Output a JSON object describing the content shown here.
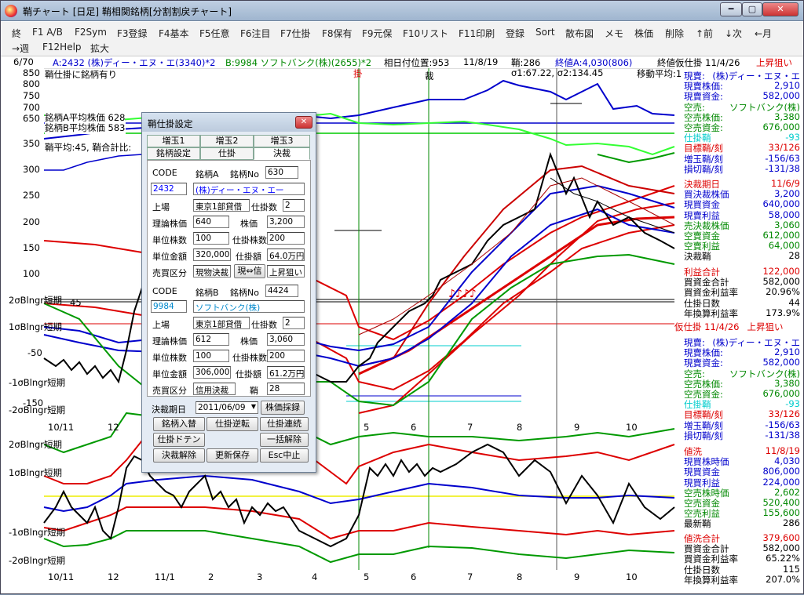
{
  "window": {
    "title": "鞘チャート [日足] 鞘相関銘柄[分割割戻チャート]"
  },
  "menu": {
    "row1": [
      "終",
      "F1 A/B",
      "F2Sym",
      "F3登録",
      "F4基本",
      "F5任意",
      "F6注目",
      "F7仕掛",
      "F8保有",
      "F9元保",
      "F10リスト",
      "F11印刷",
      "登録",
      "Sort",
      "散布図",
      "メモ",
      "株価",
      "削除",
      "↑前",
      "↓次",
      "←月"
    ],
    "row2": [
      "→週",
      "F12Help",
      "拡大"
    ]
  },
  "info": {
    "count": "6/70",
    "a": "A:2432 (株)ディー・エヌ・エ(3340)*2",
    "b": "B:9984 ソフトバンク(株)(2655)*2",
    "pos": "相日付位置:953",
    "date": "11/8/19",
    "saya": "鞘:286",
    "endval": "終値A:4,030(806)",
    "entry": "終値仮仕掛 11/4/26",
    "trend": "上昇狙い"
  },
  "chart": {
    "labels": {
      "top_left": "鞘仕掛に銘柄有り",
      "avgA": "銘柄A平均株価 628",
      "avgB": "銘柄B平均株価 583",
      "meanratio": "鞘平均:45, 鞘合計比:",
      "sigma": "σ1:67.22, σ2:134.45",
      "ma": "移動平均:1",
      "kake": "掛",
      "sai": "裁",
      "notes": "♪♪♪♪"
    },
    "yticks_top": [
      "850",
      "800",
      "750",
      "700",
      "650",
      "400",
      "350",
      "300",
      "250",
      "200",
      "150",
      "100"
    ],
    "yticks_mid": [
      "2σBlngr短期",
      "1σBlngr短期",
      "-50",
      "-1σBlngr短期",
      "-2σBlngr短期",
      "-150"
    ],
    "yticks_low": [
      "2σBlngr短期",
      "1σBlngr短期",
      "-1σBlngr短期",
      "-2σBlngr短期"
    ],
    "xticks_mid": [
      "10/11",
      "12",
      "5",
      "6",
      "7",
      "8",
      "9",
      "10"
    ],
    "xticks_low": [
      "10/11",
      "12",
      "11/1",
      "2",
      "3",
      "4",
      "5",
      "6",
      "7",
      "8",
      "9",
      "10"
    ],
    "extra": {
      "y45": "45",
      "neg100": "-100",
      "neg150": "-150"
    }
  },
  "right_panel": {
    "section1": [
      {
        "label": "現賣:",
        "value": "(株)ディー・エヌ・エ",
        "color": "#00c"
      },
      {
        "label": "現賣株価:",
        "value": "2,910",
        "color": "#00c"
      },
      {
        "label": "現賣資金:",
        "value": "582,000",
        "color": "#00c"
      },
      {
        "label": "空売:",
        "value": "ソフトバンク(株)",
        "color": "#080"
      },
      {
        "label": "空売株価:",
        "value": "3,380",
        "color": "#080"
      },
      {
        "label": "空売資金:",
        "value": "676,000",
        "color": "#080"
      },
      {
        "label": "仕掛鞘",
        "value": "-93",
        "color": "#0cc"
      },
      {
        "label": "目標鞘/刻",
        "value": "33/126",
        "color": "#d00"
      },
      {
        "label": "増玉鞘/刻",
        "value": "-156/63",
        "color": "#00c"
      },
      {
        "label": "損切鞘/刻",
        "value": "-131/38",
        "color": "#00c"
      }
    ],
    "section2": [
      {
        "label": "決裁期日",
        "value": "11/6/9",
        "color": "#d00"
      },
      {
        "label": "買決裁株価",
        "value": "3,200",
        "color": "#00c"
      },
      {
        "label": "現買資金",
        "value": "640,000",
        "color": "#00c"
      },
      {
        "label": "現賣利益",
        "value": "58,000",
        "color": "#00c"
      },
      {
        "label": "売決裁株価",
        "value": "3,060",
        "color": "#080"
      },
      {
        "label": "空賣資金",
        "value": "612,000",
        "color": "#080"
      },
      {
        "label": "空賣利益",
        "value": "64,000",
        "color": "#080"
      },
      {
        "label": "決裁鞘",
        "value": "28",
        "color": "#000"
      }
    ],
    "section3": [
      {
        "label": "利益合計",
        "value": "122,000",
        "color": "#d00"
      },
      {
        "label": "買資金合計",
        "value": "582,000",
        "color": "#000"
      },
      {
        "label": "買資金利益率",
        "value": "20.96%",
        "color": "#000"
      },
      {
        "label": "仕掛日数",
        "value": "44",
        "color": "#000"
      },
      {
        "label": "年換算利益率",
        "value": "173.9%",
        "color": "#000"
      }
    ],
    "entry2": {
      "text": "仮仕掛 11/4/26",
      "trend": "上昇狙い"
    },
    "section4": [
      {
        "label": "現賣:",
        "value": "(株)ディー・エヌ・エ",
        "color": "#00c"
      },
      {
        "label": "現賣株価:",
        "value": "2,910",
        "color": "#00c"
      },
      {
        "label": "現賣資金:",
        "value": "582,000",
        "color": "#00c"
      },
      {
        "label": "空売:",
        "value": "ソフトバンク(株)",
        "color": "#080"
      },
      {
        "label": "空売株価:",
        "value": "3,380",
        "color": "#080"
      },
      {
        "label": "空売資金:",
        "value": "676,000",
        "color": "#080"
      },
      {
        "label": "仕掛鞘",
        "value": "-93",
        "color": "#0cc"
      },
      {
        "label": "目標鞘/刻",
        "value": "33/126",
        "color": "#d00"
      },
      {
        "label": "増玉鞘/刻",
        "value": "-156/63",
        "color": "#00c"
      },
      {
        "label": "損切鞘/刻",
        "value": "-131/38",
        "color": "#00c"
      }
    ],
    "section5": [
      {
        "label": "値洗",
        "value": "11/8/19",
        "color": "#d00"
      },
      {
        "label": "現買株時価",
        "value": "4,030",
        "color": "#00c"
      },
      {
        "label": "現買資金",
        "value": "806,000",
        "color": "#00c"
      },
      {
        "label": "現買利益",
        "value": "224,000",
        "color": "#00c"
      },
      {
        "label": "空売株時価",
        "value": "2,602",
        "color": "#080"
      },
      {
        "label": "空売資金",
        "value": "520,400",
        "color": "#080"
      },
      {
        "label": "空売利益",
        "value": "155,600",
        "color": "#080"
      },
      {
        "label": "最新鞘",
        "value": "286",
        "color": "#000"
      }
    ],
    "section6": [
      {
        "label": "値洗合計",
        "value": "379,600",
        "color": "#d00"
      },
      {
        "label": "買資金合計",
        "value": "582,000",
        "color": "#000"
      },
      {
        "label": "買資金利益率",
        "value": "65.22%",
        "color": "#000"
      },
      {
        "label": "仕掛日数",
        "value": "115",
        "color": "#000"
      },
      {
        "label": "年換算利益率",
        "value": "207.0%",
        "color": "#000"
      }
    ]
  },
  "dialog": {
    "title": "鞘仕掛設定",
    "tabs_row1": [
      "増玉1",
      "増玉2",
      "増玉3"
    ],
    "tabs_row2": [
      "銘柄設定",
      "仕掛",
      "決裁"
    ],
    "a": {
      "code_label": "CODE",
      "name_label": "銘柄A",
      "no_label": "銘柄No",
      "no": "630",
      "code": "2432",
      "name": "(株)ディー・エヌ・エー",
      "market_label": "上場",
      "market": "東京1部貸借",
      "count_label": "仕掛数",
      "count": "2",
      "theory_label": "理論株価",
      "theory": "640",
      "price_label": "株価",
      "price": "3,200",
      "unit_label": "単位株数",
      "unit": "100",
      "shares_label": "仕掛株数",
      "shares": "200",
      "amount_label": "単位金額",
      "amount": "320,000",
      "total_label": "仕掛額",
      "total": "64.0万円",
      "side_label": "売買区分",
      "side": "現物決裁",
      "dir": "現⇔信",
      "aim": "上昇狙い"
    },
    "b": {
      "code_label": "CODE",
      "name_label": "銘柄B",
      "no_label": "銘柄No",
      "no": "4424",
      "code": "9984",
      "name": "ソフトバンク(株)",
      "market_label": "上場",
      "market": "東京1部貸借",
      "count_label": "仕掛数",
      "count": "2",
      "theory_label": "理論株価",
      "theory": "612",
      "price_label": "株価",
      "price": "3,060",
      "unit_label": "単位株数",
      "unit": "100",
      "shares_label": "仕掛株数",
      "shares": "200",
      "amount_label": "単位金額",
      "amount": "306,000",
      "total_label": "仕掛額",
      "total": "61.2万円",
      "side_label": "売買区分",
      "side": "信用決裁",
      "saya_label": "鞘",
      "saya": "28"
    },
    "settle_label": "決裁期日",
    "settle_date": "2011/06/09",
    "adopt": "株価採録",
    "buttons": [
      "銘柄入替",
      "仕掛逆転",
      "仕掛連続",
      "仕掛ドテン",
      "一括解除",
      "決裁解除",
      "更新保存",
      "Esc中止"
    ]
  }
}
